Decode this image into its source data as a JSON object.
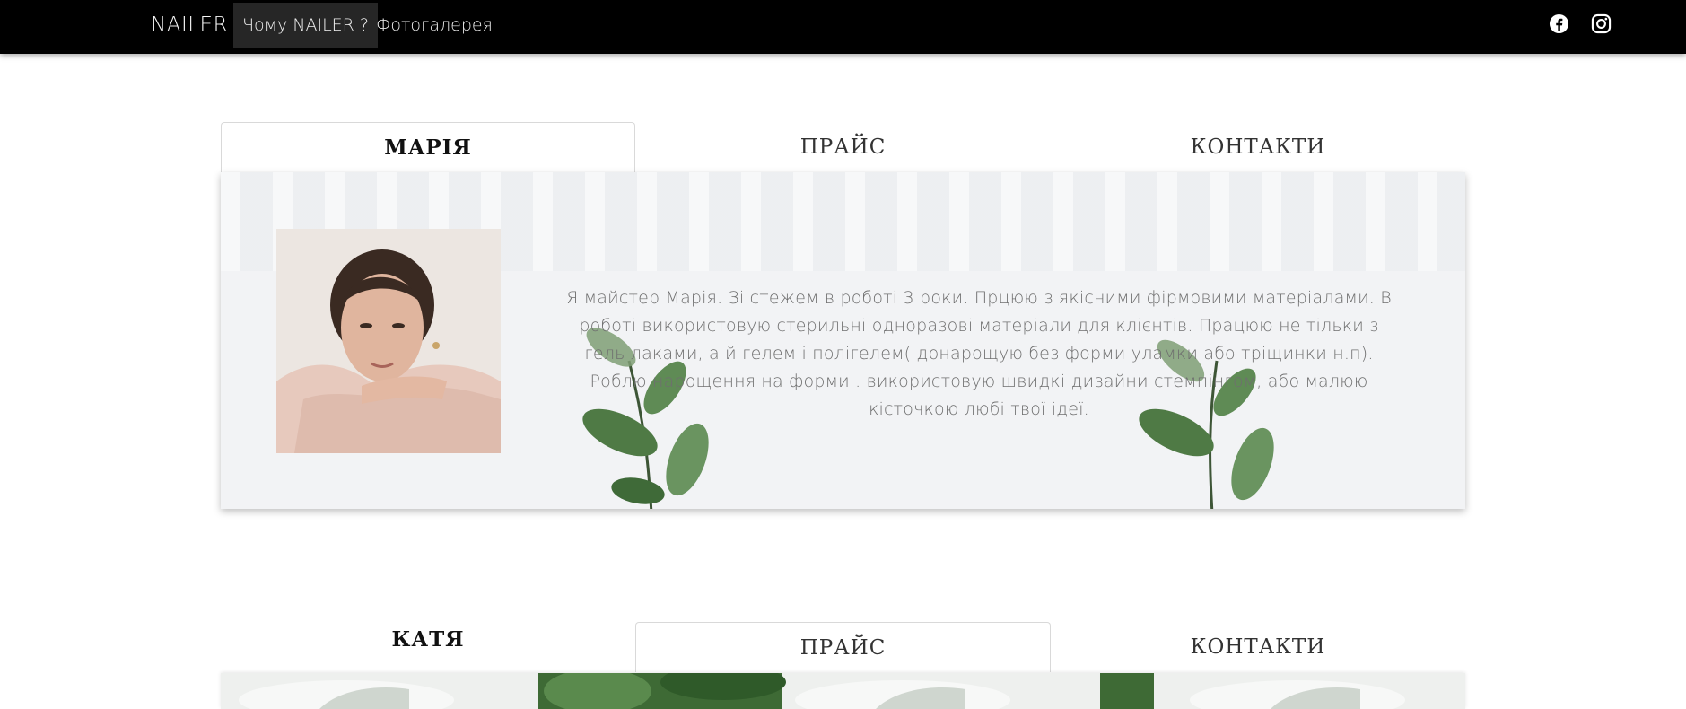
{
  "navbar": {
    "brand": "NAILER",
    "links": [
      {
        "label": "Чому NAILER ?",
        "active": true
      },
      {
        "label": "Фотогалерея",
        "active": false
      }
    ],
    "social": [
      {
        "icon": "facebook-icon"
      },
      {
        "icon": "instagram-icon"
      }
    ]
  },
  "sections": [
    {
      "tabs": [
        {
          "label": "МАРІЯ",
          "active": true
        },
        {
          "label": "ПРАЙС",
          "active": false
        },
        {
          "label": "КОНТАКТИ",
          "active": false
        }
      ],
      "bio": "Я майстер Марія. Зі стежем в роботі 3 роки. Прцюю з якісними фірмовими матеріалами. В роботі використовую стерильні одноразові матеріали для клієнтів. Працюю не тільки з гель лаками, а й гелем і полігелем( донарощую без форми уламки або тріщинки н.п). Роблю нарощення на форми . використовую швидкі дизайни стемпінгом, або малюю кісточкою любі твої ідеї."
    },
    {
      "tabs": [
        {
          "label": "КАТЯ",
          "active": false
        },
        {
          "label": "ПРАЙС",
          "active": true
        },
        {
          "label": "КОНТАКТИ",
          "active": false
        }
      ]
    }
  ],
  "colors": {
    "navbar_bg": "#000000",
    "nav_active_bg": "#262626",
    "card_bg": "#f2f3f5",
    "leaf_green": "#4f7a45",
    "bio_text": "#6f6f6f"
  }
}
